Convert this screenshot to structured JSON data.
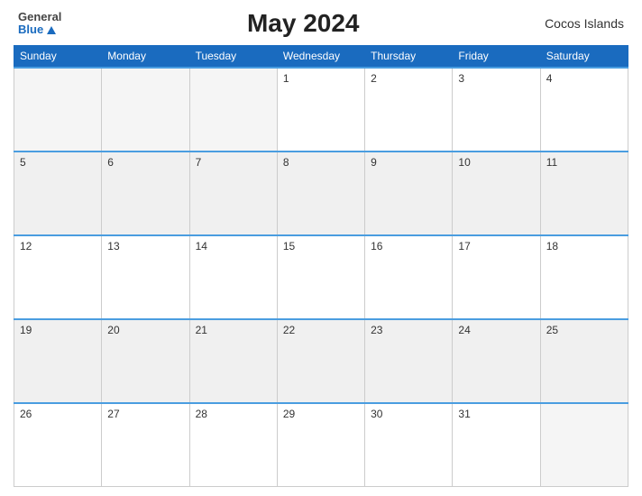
{
  "header": {
    "logo_general": "General",
    "logo_blue": "Blue",
    "title": "May 2024",
    "region": "Cocos Islands"
  },
  "calendar": {
    "days_of_week": [
      "Sunday",
      "Monday",
      "Tuesday",
      "Wednesday",
      "Thursday",
      "Friday",
      "Saturday"
    ],
    "weeks": [
      [
        {
          "num": "",
          "empty": true
        },
        {
          "num": "",
          "empty": true
        },
        {
          "num": "",
          "empty": true
        },
        {
          "num": "1",
          "empty": false
        },
        {
          "num": "2",
          "empty": false
        },
        {
          "num": "3",
          "empty": false
        },
        {
          "num": "4",
          "empty": false
        }
      ],
      [
        {
          "num": "5",
          "empty": false
        },
        {
          "num": "6",
          "empty": false
        },
        {
          "num": "7",
          "empty": false
        },
        {
          "num": "8",
          "empty": false
        },
        {
          "num": "9",
          "empty": false
        },
        {
          "num": "10",
          "empty": false
        },
        {
          "num": "11",
          "empty": false
        }
      ],
      [
        {
          "num": "12",
          "empty": false
        },
        {
          "num": "13",
          "empty": false
        },
        {
          "num": "14",
          "empty": false
        },
        {
          "num": "15",
          "empty": false
        },
        {
          "num": "16",
          "empty": false
        },
        {
          "num": "17",
          "empty": false
        },
        {
          "num": "18",
          "empty": false
        }
      ],
      [
        {
          "num": "19",
          "empty": false
        },
        {
          "num": "20",
          "empty": false
        },
        {
          "num": "21",
          "empty": false
        },
        {
          "num": "22",
          "empty": false
        },
        {
          "num": "23",
          "empty": false
        },
        {
          "num": "24",
          "empty": false
        },
        {
          "num": "25",
          "empty": false
        }
      ],
      [
        {
          "num": "26",
          "empty": false
        },
        {
          "num": "27",
          "empty": false
        },
        {
          "num": "28",
          "empty": false
        },
        {
          "num": "29",
          "empty": false
        },
        {
          "num": "30",
          "empty": false
        },
        {
          "num": "31",
          "empty": false
        },
        {
          "num": "",
          "empty": true
        }
      ]
    ]
  }
}
